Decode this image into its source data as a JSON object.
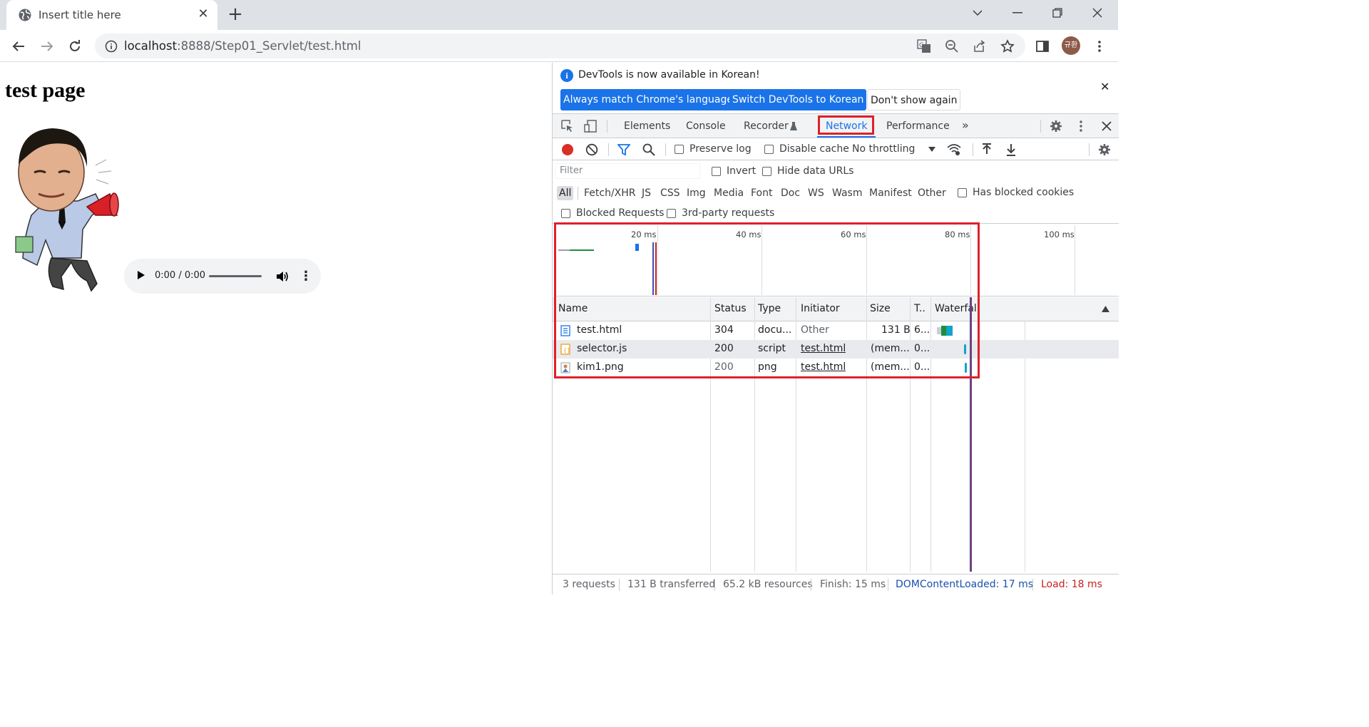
{
  "browser": {
    "tab_title": "Insert title here",
    "url_host": "localhost",
    "url_rest": ":8888/Step01_Servlet/test.html",
    "avatar_text": "규환"
  },
  "page": {
    "heading": "test page",
    "audio_time": "0:00 / 0:00"
  },
  "devtools": {
    "infobar": {
      "message": "DevTools is now available in Korean!",
      "btn_match": "Always match Chrome's language",
      "btn_switch": "Switch DevTools to Korean",
      "btn_dont": "Don't show again"
    },
    "tabs": [
      "Elements",
      "Console",
      "Recorder",
      "Network",
      "Performance"
    ],
    "active_tab": "Network",
    "toolbar": {
      "preserve_log": "Preserve log",
      "disable_cache": "Disable cache",
      "throttling": "No throttling"
    },
    "filter": {
      "placeholder": "Filter",
      "invert": "Invert",
      "hide_data_urls": "Hide data URLs"
    },
    "type_filters": [
      "All",
      "Fetch/XHR",
      "JS",
      "CSS",
      "Img",
      "Media",
      "Font",
      "Doc",
      "WS",
      "Wasm",
      "Manifest",
      "Other"
    ],
    "has_blocked_cookies": "Has blocked cookies",
    "blocked_requests": "Blocked Requests",
    "third_party": "3rd-party requests",
    "overview_ticks": [
      "20 ms",
      "40 ms",
      "60 ms",
      "80 ms",
      "100 ms"
    ],
    "columns": [
      "Name",
      "Status",
      "Type",
      "Initiator",
      "Size",
      "T..",
      "Waterfall"
    ],
    "rows": [
      {
        "name": "test.html",
        "status": "304",
        "type": "docu...",
        "initiator": "Other",
        "size": "131 B",
        "time": "6..."
      },
      {
        "name": "selector.js",
        "status": "200",
        "type": "script",
        "initiator": "test.html",
        "size": "(mem...",
        "time": "0..."
      },
      {
        "name": "kim1.png",
        "status": "200",
        "type": "png",
        "initiator": "test.html",
        "size": "(mem...",
        "time": "0..."
      }
    ],
    "status_bar": {
      "requests": "3 requests",
      "transferred": "131 B transferred",
      "resources": "65.2 kB resources",
      "finish": "Finish: 15 ms",
      "dcl": "DOMContentLoaded: 17 ms",
      "load": "Load: 18 ms"
    },
    "colors": {
      "accent": "#1a73e8",
      "highlight": "#e0202a",
      "dcl_line": "#1a4fad",
      "load_line": "#c5221f"
    }
  }
}
